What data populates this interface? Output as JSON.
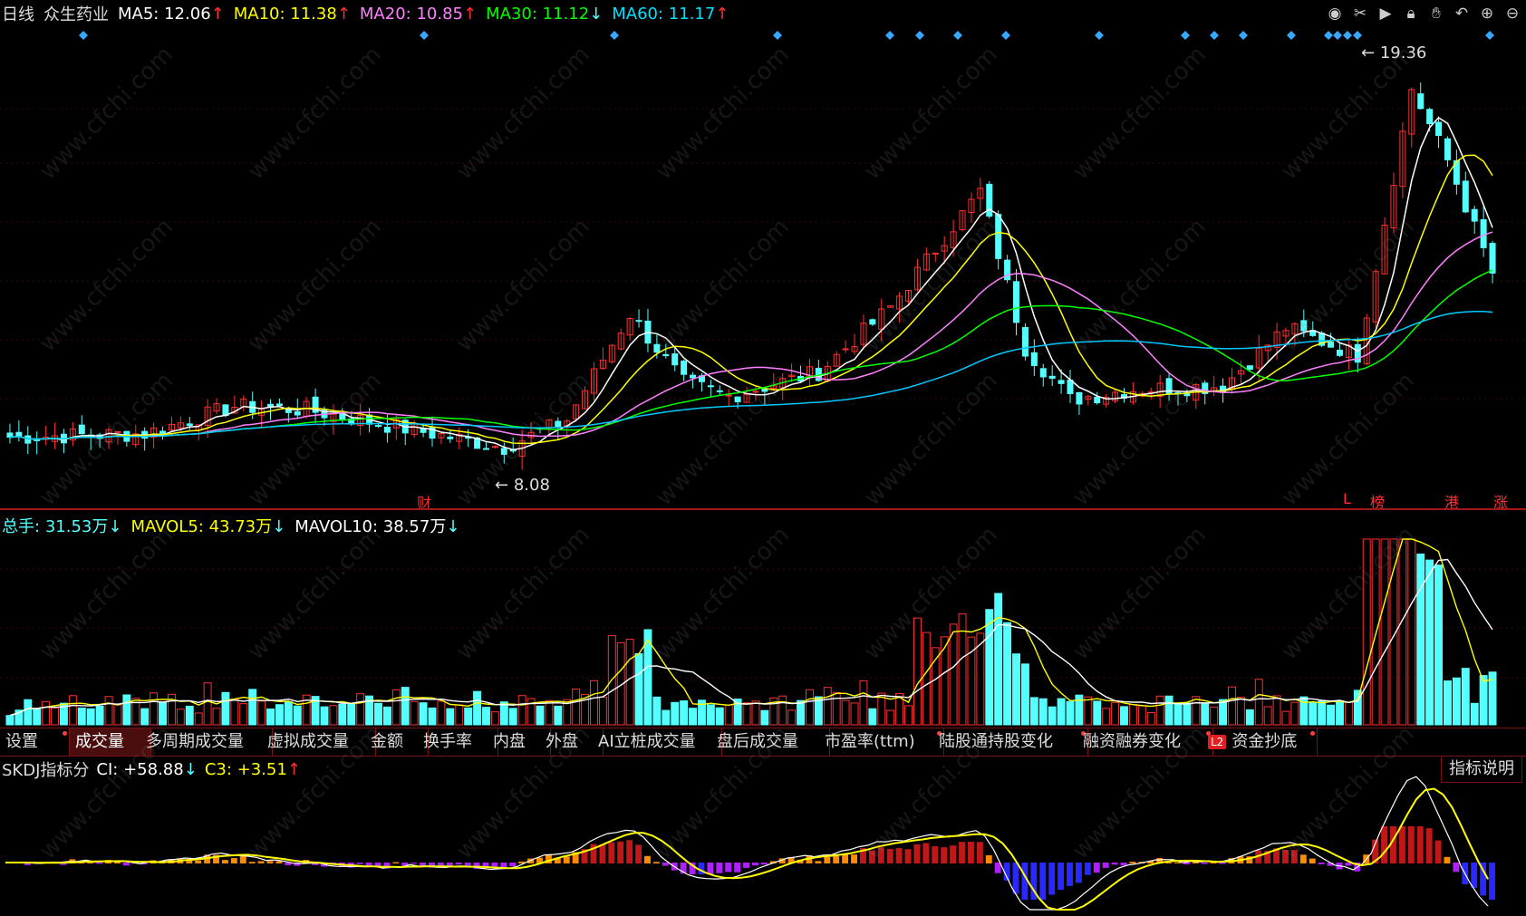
{
  "main_header": {
    "period": "日线",
    "stock_name": "众生药业",
    "ma5": {
      "label": "MA5:",
      "value": "12.06",
      "arrow": "↑",
      "color": "#ffffff"
    },
    "ma10": {
      "label": "MA10:",
      "value": "11.38",
      "arrow": "↑",
      "color": "#ffff00"
    },
    "ma20": {
      "label": "MA20:",
      "value": "10.85",
      "arrow": "↑",
      "color": "#ff80ff"
    },
    "ma30": {
      "label": "MA30:",
      "value": "11.12",
      "arrow": "↓",
      "color": "#00ff00"
    },
    "ma60": {
      "label": "MA60:",
      "value": "11.17",
      "arrow": "↑",
      "color": "#00e0ff"
    }
  },
  "toolbar_icons": [
    "eye-icon",
    "scissors-icon",
    "replay-icon",
    "lock-icon",
    "hand-icon",
    "undo-icon",
    "zoom-in-icon",
    "zoom-out-icon"
  ],
  "price_annotations": {
    "high": "19.36",
    "low": "8.08"
  },
  "event_markers": {
    "fin": "财",
    "l": "L",
    "bang": "榜",
    "gang": "港",
    "zhang": "涨"
  },
  "volume_header": {
    "total_label": "总手:",
    "total_value": "31.53万",
    "total_arrow": "↓",
    "mavol5_label": "MAVOL5:",
    "mavol5_value": "43.73万",
    "mavol5_arrow": "↓",
    "mavol10_label": "MAVOL10:",
    "mavol10_value": "38.57万",
    "mavol10_arrow": "↓"
  },
  "tabs": [
    {
      "label": "设置",
      "dot": true
    },
    {
      "label": "成交量",
      "dot": false,
      "active": true
    },
    {
      "label": "多周期成交量",
      "dot": false
    },
    {
      "label": "虚拟成交量",
      "dot": false
    },
    {
      "label": "金额",
      "dot": false
    },
    {
      "label": "换手率",
      "dot": false
    },
    {
      "label": "内盘",
      "dot": false
    },
    {
      "label": "外盘",
      "dot": false
    },
    {
      "label": "AI立桩成交量",
      "dot": false
    },
    {
      "label": "盘后成交量",
      "dot": false
    },
    {
      "label": "市盈率(ttm)",
      "dot": true
    },
    {
      "label": "陆股通持股变化",
      "dot": true
    },
    {
      "label": "融资融券变化",
      "dot": true
    },
    {
      "label": "资金抄底",
      "dot": true,
      "badge": "L2"
    }
  ],
  "indicator_header": {
    "name": "SKDJ指标分",
    "ci_label": "CI:",
    "ci_value": "+58.88",
    "ci_arrow": "↓",
    "c3_label": "C3:",
    "c3_value": "+3.51",
    "c3_arrow": "↑"
  },
  "explain_button": "指标说明",
  "watermark": "www.cfchi.com",
  "colors": {
    "up": "#ff3030",
    "down": "#54ffff",
    "ma5": "#ffffff",
    "ma10": "#ffff00",
    "ma20": "#ff80ff",
    "ma30": "#00ff00",
    "ma60": "#00c8ff",
    "grid": "#7a1010"
  }
}
